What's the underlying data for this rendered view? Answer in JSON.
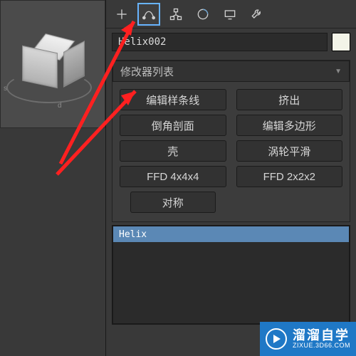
{
  "viewport": {
    "axis_s": "s",
    "axis_d": "d"
  },
  "toolbar": {
    "tooltips": {
      "create": "Create",
      "modify": "Modify",
      "hierarchy": "Hierarchy",
      "motion": "Motion",
      "display": "Display",
      "utilities": "Utilities"
    }
  },
  "object": {
    "name": "Helix002",
    "color": "#f3f4e8"
  },
  "modifier_list_label": "修改器列表",
  "buttons": [
    "编辑样条线",
    "挤出",
    "倒角剖面",
    "编辑多边形",
    "壳",
    "涡轮平滑",
    "FFD 4x4x4",
    "FFD 2x2x2"
  ],
  "center_button": "对称",
  "stack": {
    "items": [
      "Helix"
    ]
  },
  "watermark": {
    "brand": "溜溜自学",
    "url": "ZIXUE.3D66.COM"
  }
}
